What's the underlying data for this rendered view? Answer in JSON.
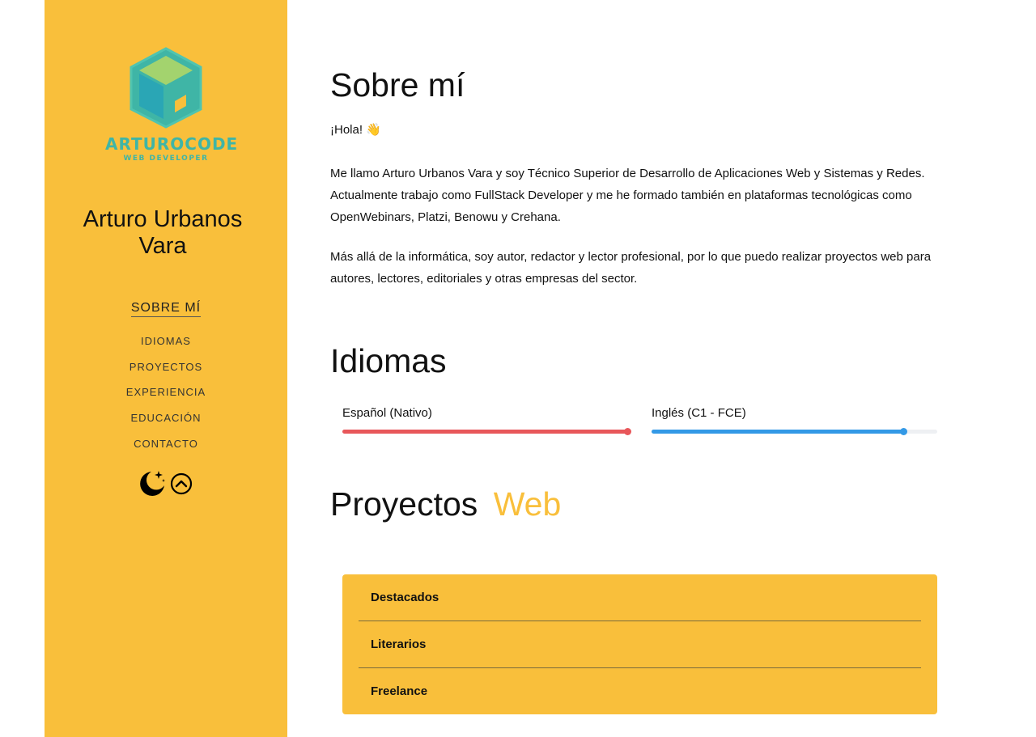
{
  "sidebar": {
    "logo_title": "ARTUROCODE",
    "logo_subtitle": "WEB DEVELOPER",
    "name_line1": "Arturo Urbanos",
    "name_line2": "Vara",
    "nav": [
      "SOBRE MÍ",
      "IDIOMAS",
      "PROYECTOS",
      "EXPERIENCIA",
      "EDUCACIÓN",
      "CONTACTO"
    ],
    "active_nav": "SOBRE MÍ",
    "icons": [
      "moon-stars-icon",
      "chevron-up-circle-icon"
    ]
  },
  "about": {
    "heading": "Sobre mí",
    "greeting": "¡Hola! 👋",
    "paragraph1": "Me llamo Arturo Urbanos Vara y soy Técnico Superior de Desarrollo de Aplicaciones Web y Sistemas y Redes. Actualmente trabajo como FullStack Developer y me he formado también en plataformas tecnológicas como OpenWebinars, Platzi, Benowu y Crehana.",
    "paragraph2": "Más allá de la informática, soy autor, redactor y lector profesional, por lo que puedo realizar proyectos web para autores, lectores, editoriales y otras empresas del sector."
  },
  "languages": {
    "heading": "Idiomas",
    "items": [
      {
        "label": "Español (Nativo)",
        "level": 1.0,
        "color": "#e8575a"
      },
      {
        "label": "Inglés (C1 - FCE)",
        "level": 0.885,
        "color": "#3399e6"
      }
    ]
  },
  "projects": {
    "heading_main": "Proyectos",
    "heading_accent": "Web",
    "accent_color": "#f9bf3b",
    "tabs": [
      "Destacados",
      "Literarios",
      "Freelance"
    ]
  },
  "colors": {
    "sidebar_bg": "#f9bf3b",
    "logo_teal": "#3fb5a6"
  }
}
